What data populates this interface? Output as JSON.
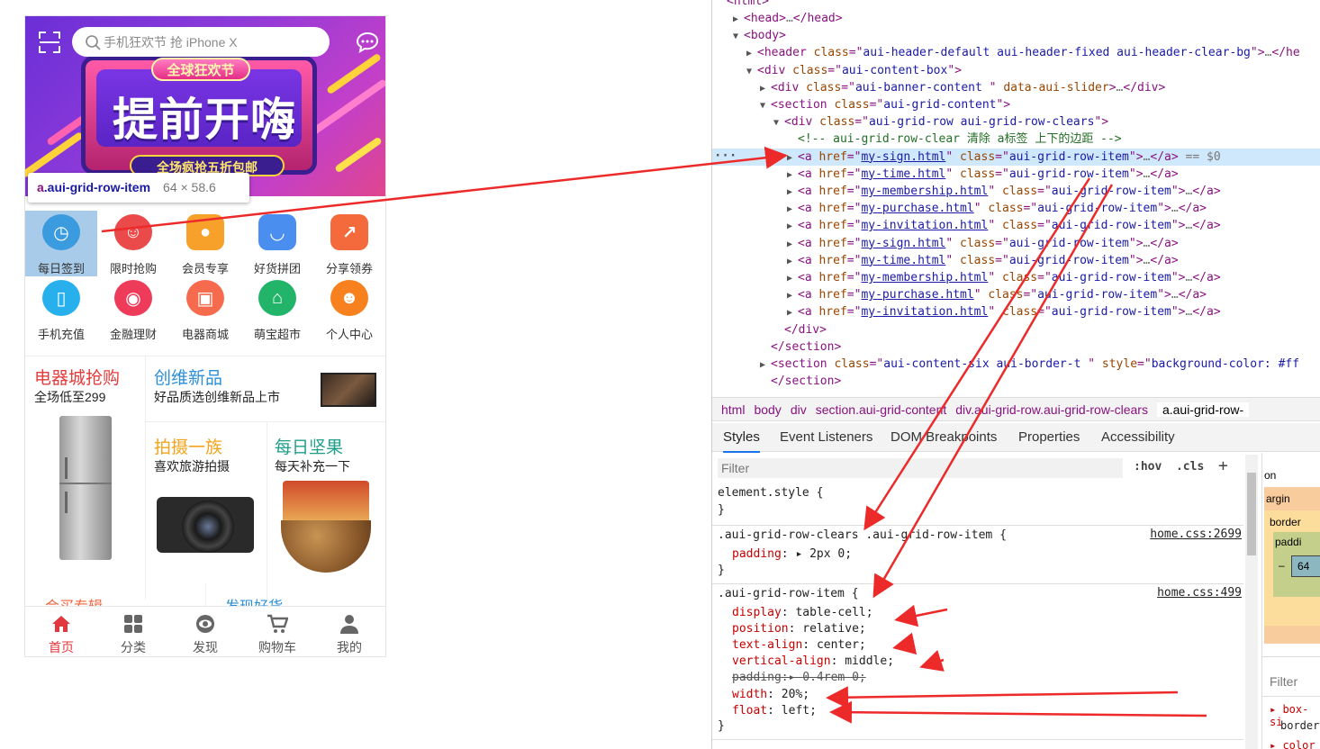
{
  "search": {
    "placeholder": "手机狂欢节 抢 iPhone X"
  },
  "banner": {
    "tag_top": "全球狂欢节",
    "headline": "提前开嗨",
    "tag_bottom": "全场疯抢五折包邮"
  },
  "tooltip": {
    "tag": "a",
    "class": ".aui-grid-row-item",
    "size": "64 × 58.6"
  },
  "grid": [
    {
      "label": "每日签到",
      "color": "#3b9bdf",
      "glyph": "◷"
    },
    {
      "label": "限时抢购",
      "color": "#ea4a4a",
      "glyph": "☺"
    },
    {
      "label": "会员专享",
      "color": "#f8a12a",
      "glyph": "●"
    },
    {
      "label": "好货拼团",
      "color": "#4a8ff0",
      "glyph": "◡"
    },
    {
      "label": "分享领券",
      "color": "#f46a3c",
      "glyph": "↗"
    },
    {
      "label": "手机充值",
      "color": "#28b0ec",
      "glyph": "▯"
    },
    {
      "label": "金融理财",
      "color": "#ee3b5a",
      "glyph": "◉"
    },
    {
      "label": "电器商城",
      "color": "#f66b4d",
      "glyph": "▣"
    },
    {
      "label": "萌宝超市",
      "color": "#22b56a",
      "glyph": "⌂"
    },
    {
      "label": "个人中心",
      "color": "#f7801f",
      "glyph": "☻"
    }
  ],
  "promo": {
    "a_title": "电器城抢购",
    "a_sub": "全场低至299",
    "b_title": "创维新品",
    "b_sub": "好品质选创维新品上市",
    "c_title": "拍摄一族",
    "c_sub": "喜欢旅游拍摄",
    "d_title": "每日坚果",
    "d_sub": "每天补充一下",
    "e_title": "会买专辑",
    "f_title": "发现好货",
    "colors": {
      "a": "#e23c3c",
      "b": "#2a8ed8",
      "c": "#f2a41c",
      "d": "#1f9e8a",
      "e": "#f0643c",
      "f": "#2a8ed8"
    }
  },
  "tabbar": [
    {
      "label": "首页",
      "active": true
    },
    {
      "label": "分类",
      "active": false
    },
    {
      "label": "发现",
      "active": false
    },
    {
      "label": "购物车",
      "active": false
    },
    {
      "label": "我的",
      "active": false
    }
  ],
  "devtools": {
    "dom": [
      {
        "type": "tag",
        "indent": 1,
        "tri": "▶",
        "parts": [
          [
            "t",
            "<head>"
          ],
          [
            "d",
            "…"
          ],
          [
            "t",
            "</head>"
          ]
        ]
      },
      {
        "type": "tag",
        "indent": 1,
        "tri": "▼",
        "parts": [
          [
            "t",
            "<body>"
          ]
        ]
      },
      {
        "type": "tag",
        "indent": 2,
        "tri": "▶",
        "parts": [
          [
            "t",
            "<header "
          ],
          [
            "a",
            "class"
          ],
          [
            "t",
            "=\""
          ],
          [
            "v",
            "aui-header-default aui-header-fixed aui-header-clear-bg"
          ],
          [
            "t",
            "\">"
          ],
          [
            "d",
            "…"
          ],
          [
            "t",
            "</he"
          ]
        ]
      },
      {
        "type": "tag",
        "indent": 2,
        "tri": "▼",
        "parts": [
          [
            "t",
            "<div "
          ],
          [
            "a",
            "class"
          ],
          [
            "t",
            "=\""
          ],
          [
            "v",
            "aui-content-box"
          ],
          [
            "t",
            "\">"
          ]
        ]
      },
      {
        "type": "tag",
        "indent": 3,
        "tri": "▶",
        "parts": [
          [
            "t",
            "<div "
          ],
          [
            "a",
            "class"
          ],
          [
            "t",
            "=\""
          ],
          [
            "v",
            "aui-banner-content "
          ],
          [
            "t",
            "\" "
          ],
          [
            "a",
            "data-aui-slider"
          ],
          [
            "t",
            ">"
          ],
          [
            "d",
            "…"
          ],
          [
            "t",
            "</div>"
          ]
        ]
      },
      {
        "type": "tag",
        "indent": 3,
        "tri": "▼",
        "parts": [
          [
            "t",
            "<section "
          ],
          [
            "a",
            "class"
          ],
          [
            "t",
            "=\""
          ],
          [
            "v",
            "aui-grid-content"
          ],
          [
            "t",
            "\">"
          ]
        ]
      },
      {
        "type": "tag",
        "indent": 4,
        "tri": "▼",
        "parts": [
          [
            "t",
            "<div "
          ],
          [
            "a",
            "class"
          ],
          [
            "t",
            "=\""
          ],
          [
            "v",
            "aui-grid-row aui-grid-row-clears"
          ],
          [
            "t",
            "\">"
          ]
        ]
      },
      {
        "type": "comment",
        "indent": 5,
        "tri": "",
        "parts": [
          [
            "c",
            "<!-- aui-grid-row-clear 清除 a标签 上下的边距 -->"
          ]
        ]
      },
      {
        "type": "tag",
        "indent": 5,
        "tri": "▶",
        "sel": true,
        "parts": [
          [
            "t",
            "<a "
          ],
          [
            "a",
            "href"
          ],
          [
            "t",
            "=\""
          ],
          [
            "l",
            "my-sign.html"
          ],
          [
            "t",
            "\" "
          ],
          [
            "a",
            "class"
          ],
          [
            "t",
            "=\""
          ],
          [
            "v",
            "aui-grid-row-item"
          ],
          [
            "t",
            "\">"
          ],
          [
            "d",
            "…"
          ],
          [
            "t",
            "</a>"
          ],
          [
            "d",
            " == $0"
          ]
        ]
      },
      {
        "type": "tag",
        "indent": 5,
        "tri": "▶",
        "parts": [
          [
            "t",
            "<a "
          ],
          [
            "a",
            "href"
          ],
          [
            "t",
            "=\""
          ],
          [
            "l",
            "my-time.html"
          ],
          [
            "t",
            "\" "
          ],
          [
            "a",
            "class"
          ],
          [
            "t",
            "=\""
          ],
          [
            "v",
            "aui-grid-row-item"
          ],
          [
            "t",
            "\">"
          ],
          [
            "d",
            "…"
          ],
          [
            "t",
            "</a>"
          ]
        ]
      },
      {
        "type": "tag",
        "indent": 5,
        "tri": "▶",
        "parts": [
          [
            "t",
            "<a "
          ],
          [
            "a",
            "href"
          ],
          [
            "t",
            "=\""
          ],
          [
            "l",
            "my-membership.html"
          ],
          [
            "t",
            "\" "
          ],
          [
            "a",
            "class"
          ],
          [
            "t",
            "=\""
          ],
          [
            "v",
            "aui-grid-row-item"
          ],
          [
            "t",
            "\">"
          ],
          [
            "d",
            "…"
          ],
          [
            "t",
            "</a>"
          ]
        ]
      },
      {
        "type": "tag",
        "indent": 5,
        "tri": "▶",
        "parts": [
          [
            "t",
            "<a "
          ],
          [
            "a",
            "href"
          ],
          [
            "t",
            "=\""
          ],
          [
            "l",
            "my-purchase.html"
          ],
          [
            "t",
            "\" "
          ],
          [
            "a",
            "class"
          ],
          [
            "t",
            "=\""
          ],
          [
            "v",
            "aui-grid-row-item"
          ],
          [
            "t",
            "\">"
          ],
          [
            "d",
            "…"
          ],
          [
            "t",
            "</a>"
          ]
        ]
      },
      {
        "type": "tag",
        "indent": 5,
        "tri": "▶",
        "parts": [
          [
            "t",
            "<a "
          ],
          [
            "a",
            "href"
          ],
          [
            "t",
            "=\""
          ],
          [
            "l",
            "my-invitation.html"
          ],
          [
            "t",
            "\" "
          ],
          [
            "a",
            "class"
          ],
          [
            "t",
            "=\""
          ],
          [
            "v",
            "aui-grid-row-item"
          ],
          [
            "t",
            "\">"
          ],
          [
            "d",
            "…"
          ],
          [
            "t",
            "</a>"
          ]
        ]
      },
      {
        "type": "tag",
        "indent": 5,
        "tri": "▶",
        "parts": [
          [
            "t",
            "<a "
          ],
          [
            "a",
            "href"
          ],
          [
            "t",
            "=\""
          ],
          [
            "l",
            "my-sign.html"
          ],
          [
            "t",
            "\" "
          ],
          [
            "a",
            "class"
          ],
          [
            "t",
            "=\""
          ],
          [
            "v",
            "aui-grid-row-item"
          ],
          [
            "t",
            "\">"
          ],
          [
            "d",
            "…"
          ],
          [
            "t",
            "</a>"
          ]
        ]
      },
      {
        "type": "tag",
        "indent": 5,
        "tri": "▶",
        "parts": [
          [
            "t",
            "<a "
          ],
          [
            "a",
            "href"
          ],
          [
            "t",
            "=\""
          ],
          [
            "l",
            "my-time.html"
          ],
          [
            "t",
            "\" "
          ],
          [
            "a",
            "class"
          ],
          [
            "t",
            "=\""
          ],
          [
            "v",
            "aui-grid-row-item"
          ],
          [
            "t",
            "\">"
          ],
          [
            "d",
            "…"
          ],
          [
            "t",
            "</a>"
          ]
        ]
      },
      {
        "type": "tag",
        "indent": 5,
        "tri": "▶",
        "parts": [
          [
            "t",
            "<a "
          ],
          [
            "a",
            "href"
          ],
          [
            "t",
            "=\""
          ],
          [
            "l",
            "my-membership.html"
          ],
          [
            "t",
            "\" "
          ],
          [
            "a",
            "class"
          ],
          [
            "t",
            "=\""
          ],
          [
            "v",
            "aui-grid-row-item"
          ],
          [
            "t",
            "\">"
          ],
          [
            "d",
            "…"
          ],
          [
            "t",
            "</a>"
          ]
        ]
      },
      {
        "type": "tag",
        "indent": 5,
        "tri": "▶",
        "parts": [
          [
            "t",
            "<a "
          ],
          [
            "a",
            "href"
          ],
          [
            "t",
            "=\""
          ],
          [
            "l",
            "my-purchase.html"
          ],
          [
            "t",
            "\" "
          ],
          [
            "a",
            "class"
          ],
          [
            "t",
            "=\""
          ],
          [
            "v",
            "aui-grid-row-item"
          ],
          [
            "t",
            "\">"
          ],
          [
            "d",
            "…"
          ],
          [
            "t",
            "</a>"
          ]
        ]
      },
      {
        "type": "tag",
        "indent": 5,
        "tri": "▶",
        "parts": [
          [
            "t",
            "<a "
          ],
          [
            "a",
            "href"
          ],
          [
            "t",
            "=\""
          ],
          [
            "l",
            "my-invitation.html"
          ],
          [
            "t",
            "\" "
          ],
          [
            "a",
            "class"
          ],
          [
            "t",
            "=\""
          ],
          [
            "v",
            "aui-grid-row-item"
          ],
          [
            "t",
            "\">"
          ],
          [
            "d",
            "…"
          ],
          [
            "t",
            "</a>"
          ]
        ]
      },
      {
        "type": "tag",
        "indent": 4,
        "tri": "",
        "parts": [
          [
            "t",
            "</div>"
          ]
        ]
      },
      {
        "type": "tag",
        "indent": 3,
        "tri": "",
        "parts": [
          [
            "t",
            "</section>"
          ]
        ]
      },
      {
        "type": "tag",
        "indent": 3,
        "tri": "▶",
        "parts": [
          [
            "t",
            "<section "
          ],
          [
            "a",
            "class"
          ],
          [
            "t",
            "=\""
          ],
          [
            "v",
            "aui-content-six aui-border-t "
          ],
          [
            "t",
            "\" "
          ],
          [
            "a",
            "style"
          ],
          [
            "t",
            "=\""
          ],
          [
            "v",
            "background-color: #ff"
          ]
        ]
      },
      {
        "type": "tag",
        "indent": 3,
        "tri": "",
        "parts": [
          [
            "t",
            "</section>"
          ]
        ]
      }
    ],
    "breadcrumbs": [
      "html",
      "body",
      "div",
      "section.aui-grid-content",
      "div.aui-grid-row.aui-grid-row-clears",
      "a.aui-grid-row-"
    ],
    "tabs": [
      "Styles",
      "Event Listeners",
      "DOM Breakpoints",
      "Properties",
      "Accessibility"
    ],
    "filter_placeholder": "Filter",
    "hov": ":hov",
    "cls": ".cls",
    "plus": "+",
    "rules": {
      "element_style": "element.style {",
      "rule1_selector": ".aui-grid-row-clears .aui-grid-row-item {",
      "rule1_source": "home.css:2699",
      "rule1_prop": "padding",
      "rule1_val": "2px 0;",
      "rule2_selector": ".aui-grid-row-item {",
      "rule2_source": "home.css:499",
      "props": [
        {
          "name": "display",
          "value": "table-cell;",
          "struck": false
        },
        {
          "name": "position",
          "value": "relative;",
          "struck": false
        },
        {
          "name": "text-align",
          "value": "center;",
          "struck": false
        },
        {
          "name": "vertical-align",
          "value": "middle;",
          "struck": false
        },
        {
          "name": "padding",
          "value": "0.4rem 0;",
          "struck": true
        },
        {
          "name": "width",
          "value": "20%;",
          "struck": false
        },
        {
          "name": "float",
          "value": "left;",
          "struck": false
        }
      ],
      "close": "}"
    },
    "boxmodel": {
      "margin": "argin",
      "border": "border",
      "padding": "paddi",
      "content": "64",
      "on": "on",
      "dash": "–"
    },
    "right_filter": "Filter",
    "right_props": [
      "box-si",
      "border",
      "color"
    ]
  },
  "colors": {
    "arrow": "#ec2a2a",
    "selection": "#cfe8fc",
    "accent": "#1a73e8"
  }
}
